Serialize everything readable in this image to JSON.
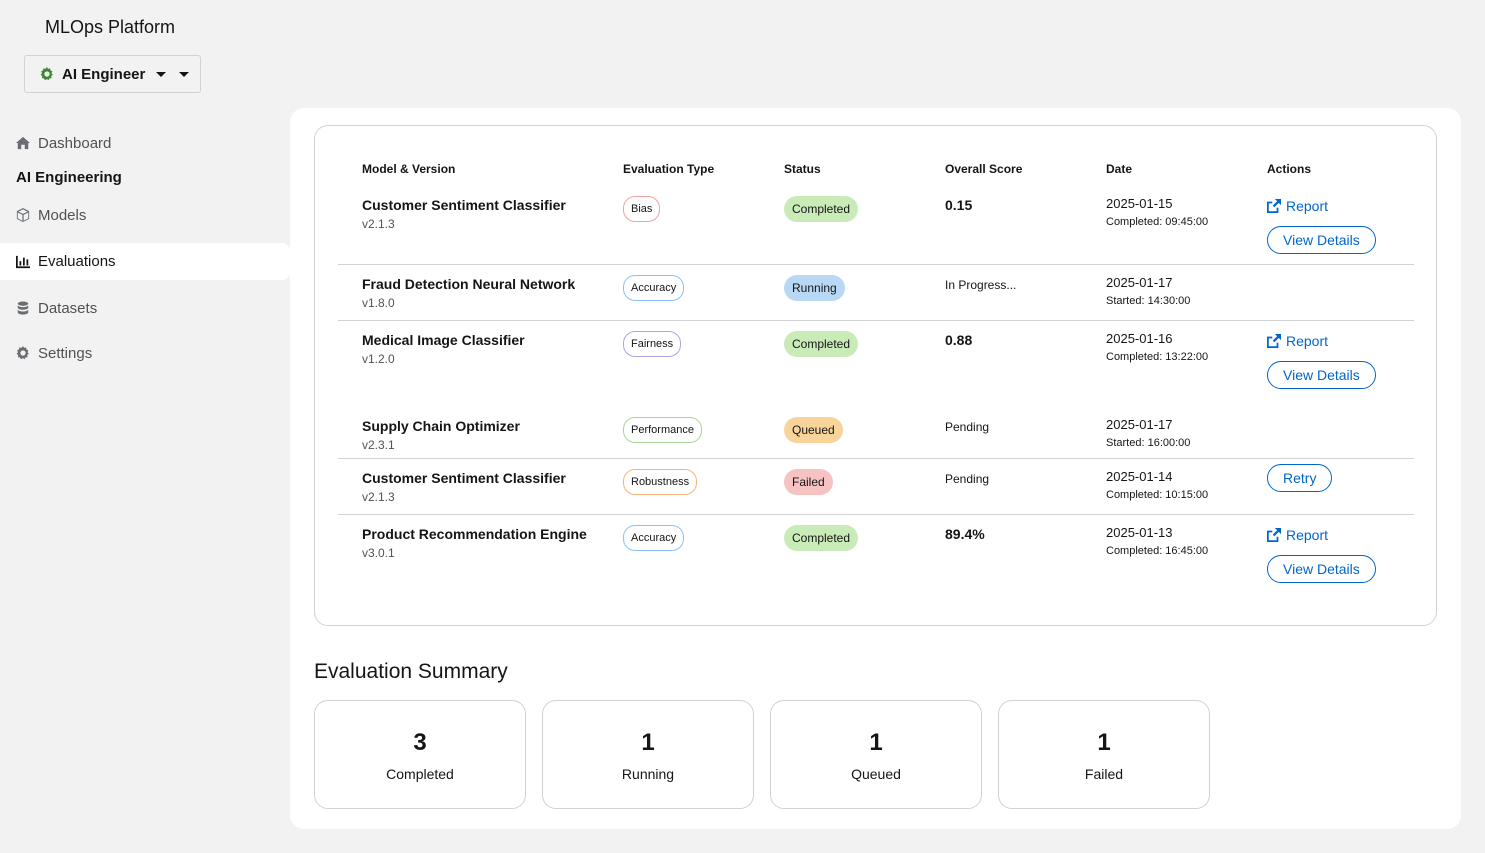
{
  "app": {
    "title": "MLOps Platform"
  },
  "role_selector": {
    "label": "AI Engineer",
    "icon": "gear-icon",
    "icon_color": "#3e8635"
  },
  "nav": {
    "dashboard": "Dashboard",
    "group": "AI Engineering",
    "models": "Models",
    "evaluations": "Evaluations",
    "datasets": "Datasets",
    "settings": "Settings"
  },
  "table": {
    "headers": [
      "Model & Version",
      "Evaluation Type",
      "Status",
      "Overall Score",
      "Date",
      "Actions"
    ],
    "rows": [
      {
        "name": "Customer Sentiment Classifier",
        "version": "v2.1.3",
        "type": "Bias",
        "status": "Completed",
        "score": "0.15",
        "date": "2025-01-15",
        "sub": "Completed: 09:45:00",
        "report": "Report",
        "button": "View Details"
      },
      {
        "name": "Fraud Detection Neural Network",
        "version": "v1.8.0",
        "type": "Accuracy",
        "status": "Running",
        "score": "In Progress...",
        "date": "2025-01-17",
        "sub": "Started: 14:30:00"
      },
      {
        "name": "Medical Image Classifier",
        "version": "v1.2.0",
        "type": "Fairness",
        "status": "Completed",
        "score": "0.88",
        "date": "2025-01-16",
        "sub": "Completed: 13:22:00",
        "report": "Report",
        "button": "View Details"
      },
      {
        "name": "Supply Chain Optimizer",
        "version": "v2.3.1",
        "type": "Performance",
        "status": "Queued",
        "score": "Pending",
        "date": "2025-01-17",
        "sub": "Started: 16:00:00"
      },
      {
        "name": "Customer Sentiment Classifier",
        "version": "v2.1.3",
        "type": "Robustness",
        "status": "Failed",
        "score": "Pending",
        "date": "2025-01-14",
        "sub": "Completed: 10:15:00",
        "button": "Retry"
      },
      {
        "name": "Product Recommendation Engine",
        "version": "v3.0.1",
        "type": "Accuracy",
        "status": "Completed",
        "score": "89.4%",
        "date": "2025-01-13",
        "sub": "Completed: 16:45:00",
        "report": "Report",
        "button": "View Details"
      }
    ]
  },
  "type_colors": {
    "Bias": "#f0a3a3",
    "Accuracy": "#8bc1f7",
    "Fairness": "#b2a3e0",
    "Performance": "#a8d59a",
    "Robustness": "#f4b678"
  },
  "status_colors": {
    "Completed": "#c8ebb8",
    "Running": "#b9d8f5",
    "Queued": "#f9d49a",
    "Failed": "#f6c2c2"
  },
  "summary": {
    "title": "Evaluation Summary",
    "cards": [
      {
        "count": "3",
        "label": "Completed"
      },
      {
        "count": "1",
        "label": "Running"
      },
      {
        "count": "1",
        "label": "Queued"
      },
      {
        "count": "1",
        "label": "Failed"
      }
    ]
  }
}
